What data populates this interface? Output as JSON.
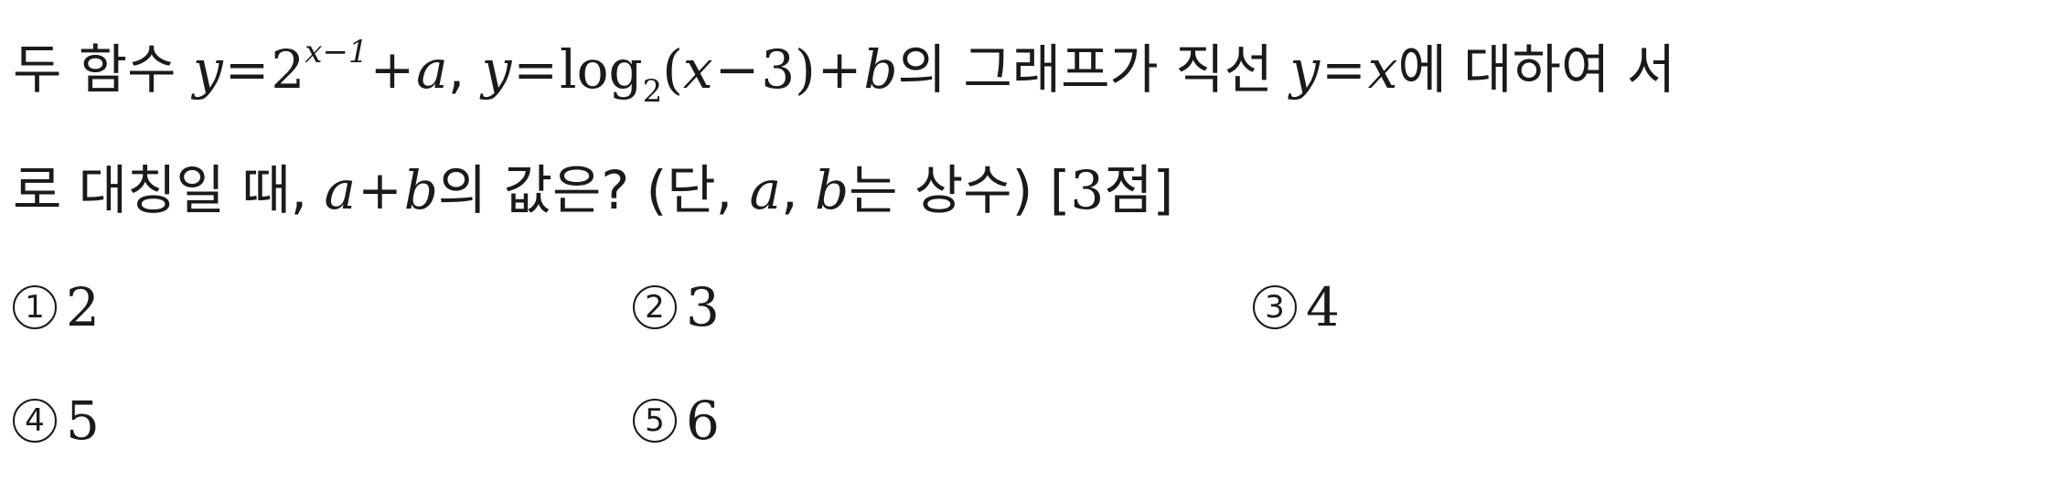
{
  "question": {
    "line1": {
      "t1": "두 함수 ",
      "y1": "y",
      "eq1": "=",
      "two": "2",
      "exp": "x−1",
      "plus1": "+",
      "a1": "a",
      "comma1": ", ",
      "y2": "y",
      "eq2": "=",
      "log": "log",
      "base": "2",
      "lp": "(",
      "x1": "x",
      "minus": "−",
      "three": "3",
      "rp": ")",
      "plus2": "+",
      "b1": "b",
      "t2": "의 그래프가 직선 ",
      "y3": "y",
      "eq3": "=",
      "x2": "x",
      "t3": "에 대하여 서"
    },
    "line2": {
      "t1": "로 대칭일 때, ",
      "a1": "a",
      "plus": "+",
      "b1": "b",
      "t2": "의 값은? (단, ",
      "a2": "a",
      "comma": ", ",
      "b2": "b",
      "t3": "는 상수) [",
      "points": "3",
      "t4": "점]"
    }
  },
  "choices": [
    {
      "num": "1",
      "value": "2"
    },
    {
      "num": "2",
      "value": "3"
    },
    {
      "num": "3",
      "value": "4"
    },
    {
      "num": "4",
      "value": "5"
    },
    {
      "num": "5",
      "value": "6"
    }
  ]
}
